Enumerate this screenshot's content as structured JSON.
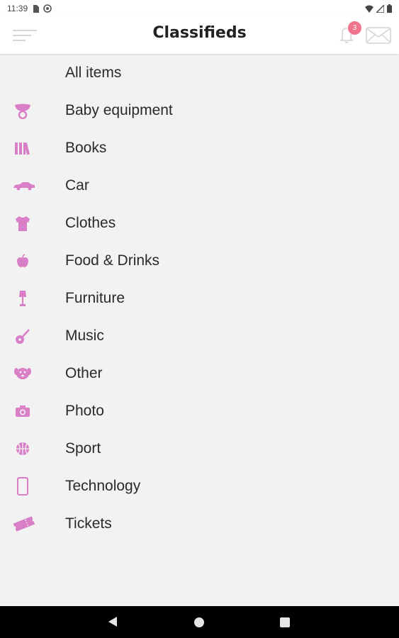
{
  "status_bar": {
    "time": "11:39"
  },
  "app_bar": {
    "title": "Classifieds",
    "notification_count": "3"
  },
  "accent_color": "#d97fc8",
  "categories": [
    {
      "label": "All items",
      "icon": "none"
    },
    {
      "label": "Baby equipment",
      "icon": "pacifier-icon"
    },
    {
      "label": "Books",
      "icon": "books-icon"
    },
    {
      "label": "Car",
      "icon": "car-icon"
    },
    {
      "label": "Clothes",
      "icon": "tshirt-icon"
    },
    {
      "label": "Food & Drinks",
      "icon": "apple-icon"
    },
    {
      "label": "Furniture",
      "icon": "lamp-icon"
    },
    {
      "label": "Music",
      "icon": "guitar-icon"
    },
    {
      "label": "Other",
      "icon": "dog-icon"
    },
    {
      "label": "Photo",
      "icon": "camera-icon"
    },
    {
      "label": "Sport",
      "icon": "basketball-icon"
    },
    {
      "label": "Technology",
      "icon": "phone-icon"
    },
    {
      "label": "Tickets",
      "icon": "ticket-icon"
    }
  ]
}
